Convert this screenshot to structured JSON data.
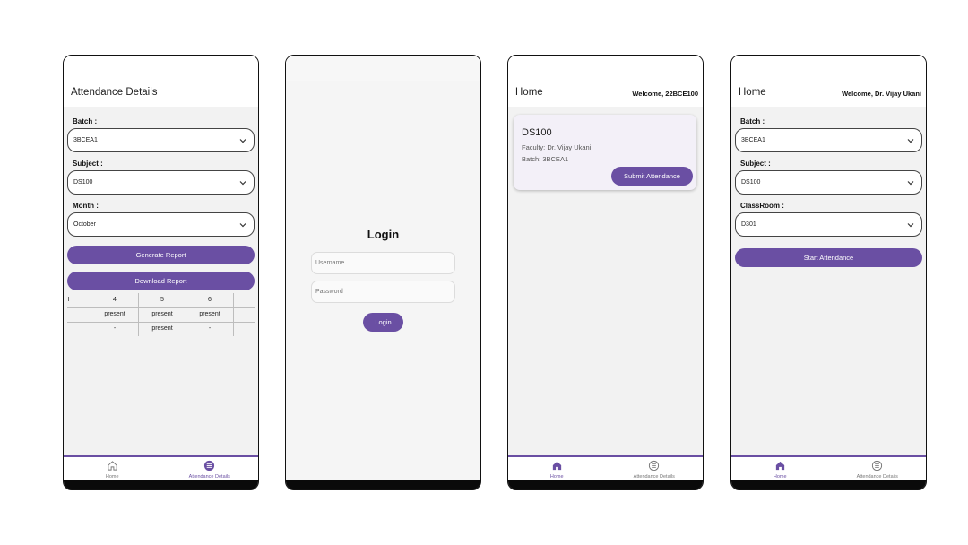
{
  "screen1": {
    "title": "Attendance Details",
    "batch_label": "Batch :",
    "batch_value": "3BCEA1",
    "subject_label": "Subject :",
    "subject_value": "DS100",
    "month_label": "Month :",
    "month_value": "October",
    "generate_label": "Generate Report",
    "download_label": "Download Report",
    "table": {
      "headers": [
        "I",
        "4",
        "5",
        "6"
      ],
      "rows": [
        [
          "",
          "present",
          "present",
          "present"
        ],
        [
          "",
          "-",
          "present",
          "-"
        ]
      ]
    },
    "nav": {
      "home": "Home",
      "attendance": "Attendance Details"
    }
  },
  "screen2": {
    "title": "Login",
    "username_placeholder": "Username",
    "password_placeholder": "Password",
    "login_label": "Login"
  },
  "screen3": {
    "title": "Home",
    "welcome": "Welcome, 22BCE100",
    "card": {
      "course": "DS100",
      "faculty": "Faculty: Dr. Vijay Ukani",
      "batch": "Batch: 3BCEA1",
      "submit_label": "Submit Attendance"
    },
    "nav": {
      "home": "Home",
      "attendance": "Attendance Details"
    }
  },
  "screen4": {
    "title": "Home",
    "welcome": "Welcome, Dr. Vijay Ukani",
    "batch_label": "Batch :",
    "batch_value": "3BCEA1",
    "subject_label": "Subject :",
    "subject_value": "DS100",
    "classroom_label": "ClassRoom :",
    "classroom_value": "D301",
    "start_label": "Start Attendance",
    "nav": {
      "home": "Home",
      "attendance": "Attendance Details"
    }
  },
  "theme": {
    "accent": "#6a4fa3",
    "nav_bar": "#0a0a0a",
    "background": "#f2f2f2"
  },
  "icons": [
    "chevron-down-icon",
    "home-icon",
    "list-icon"
  ]
}
